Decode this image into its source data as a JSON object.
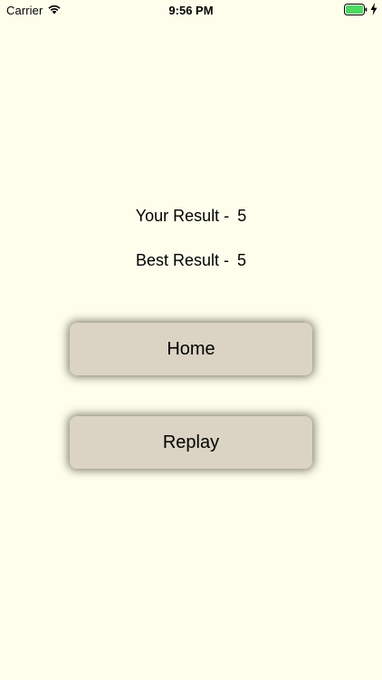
{
  "status_bar": {
    "carrier": "Carrier",
    "time": "9:56 PM",
    "battery_color": "#4cd964"
  },
  "results": {
    "your_label": "Your Result -",
    "your_value": "5",
    "best_label": "Best Result -",
    "best_value": "5"
  },
  "buttons": {
    "home_label": "Home",
    "replay_label": "Replay"
  }
}
